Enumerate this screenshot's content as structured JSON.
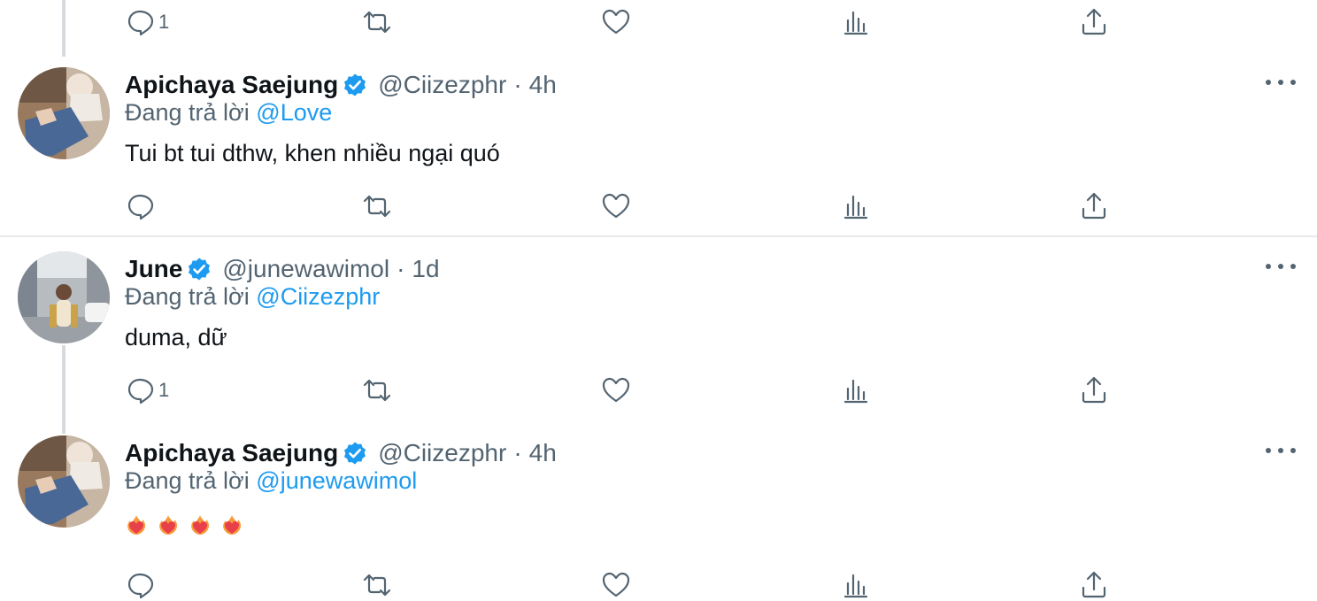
{
  "tweets": [
    {
      "name": "Apichaya Saejung",
      "handle": "@Ciizezphr",
      "sep": "·",
      "time": "4h",
      "replying_prefix": "Đang trả lời",
      "replying_to": "@Love",
      "text": "Tui bt tui dthw, khen nhiều ngại quó",
      "reply_count": ""
    },
    {
      "name": "June",
      "handle": "@junewawimol",
      "sep": "·",
      "time": "1d",
      "replying_prefix": "Đang trả lời",
      "replying_to": "@Ciizezphr",
      "text": "duma, dữ",
      "reply_count": "1"
    },
    {
      "name": "Apichaya Saejung",
      "handle": "@Ciizezphr",
      "sep": "·",
      "time": "4h",
      "replying_prefix": "Đang trả lời",
      "replying_to": "@junewawimol",
      "text": "",
      "emojis": [
        "heart-on-fire",
        "heart-on-fire",
        "heart-on-fire",
        "heart-on-fire"
      ],
      "reply_count": ""
    }
  ],
  "top_action_bar": {
    "reply_count": "1"
  },
  "icons": [
    "reply-icon",
    "retweet-icon",
    "like-icon",
    "views-icon",
    "share-icon",
    "verified-badge-icon",
    "more-icon"
  ],
  "colors": {
    "link": "#1d9bf0",
    "verified": "#1d9bf0",
    "muted": "#536471",
    "text": "#0f1419"
  }
}
